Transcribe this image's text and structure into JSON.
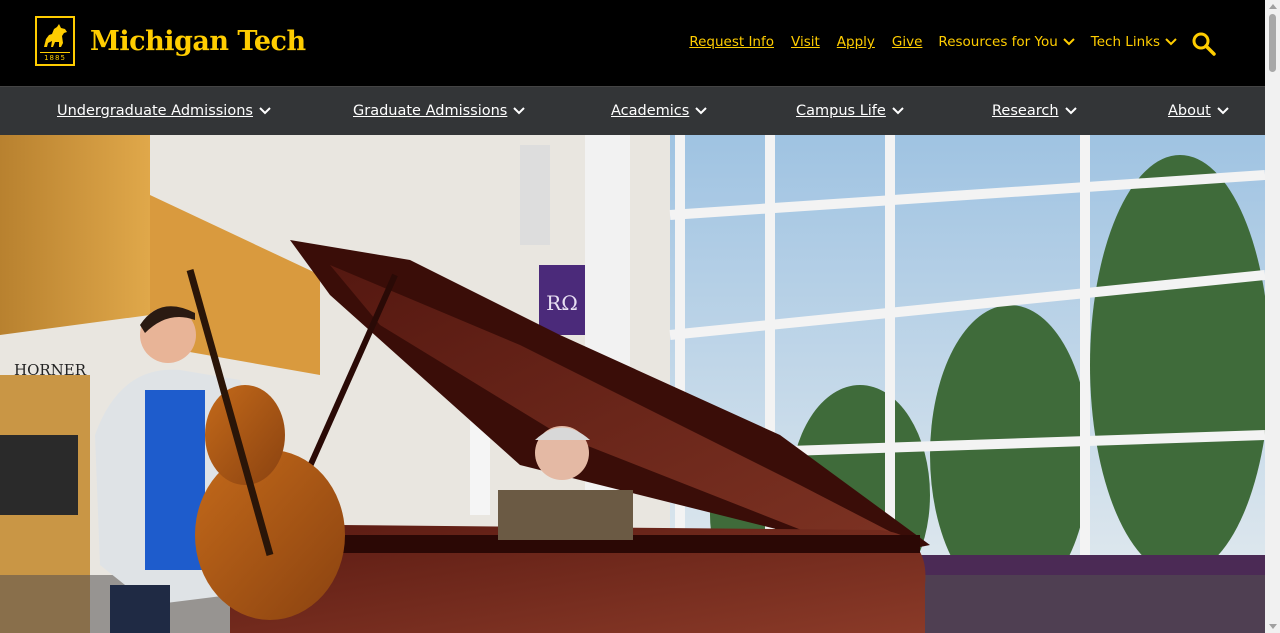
{
  "brand": {
    "name": "Michigan Tech",
    "year": "1885",
    "accent_color": "#ffcd00"
  },
  "utility_nav": {
    "links": [
      "Request Info",
      "Visit",
      "Apply",
      "Give"
    ],
    "dropdowns": [
      "Resources for You",
      "Tech Links"
    ],
    "search_icon": "search-icon"
  },
  "main_nav": {
    "items": [
      "Undergraduate Admissions",
      "Graduate Admissions",
      "Academics",
      "Campus Life",
      "Research",
      "About"
    ]
  },
  "hero": {
    "sign_text": "HORNER",
    "banner_text": "RΩ"
  }
}
